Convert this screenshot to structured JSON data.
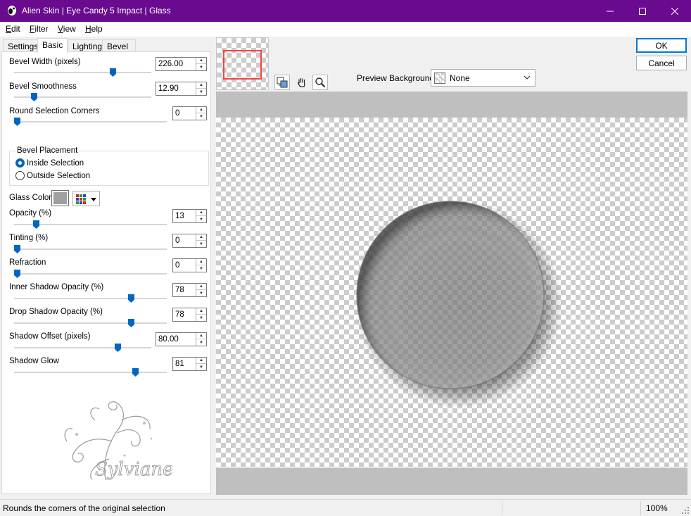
{
  "window": {
    "title": "Alien Skin | Eye Candy 5 Impact | Glass"
  },
  "menu": [
    {
      "key": "E",
      "rest": "dit"
    },
    {
      "key": "F",
      "rest": "ilter"
    },
    {
      "key": "V",
      "rest": "iew"
    },
    {
      "key": "H",
      "rest": "elp"
    }
  ],
  "tabs": {
    "settings": "Settings",
    "basic": "Basic",
    "lighting": "Lighting",
    "bevel_profile": "Bevel Profile",
    "active": "Basic"
  },
  "controls": {
    "bevel_width": {
      "label": "Bevel Width (pixels)",
      "value": "226.00",
      "level": 0.73
    },
    "bevel_smoothness": {
      "label": "Bevel Smoothness",
      "value": "12.90",
      "level": 0.13
    },
    "round_corners": {
      "label": "Round Selection Corners",
      "value": "0",
      "level": 0.0
    },
    "bevel_placement": {
      "legend": "Bevel Placement",
      "inside": "Inside Selection",
      "outside": "Outside Selection",
      "selected": "inside"
    },
    "glass_color": {
      "label": "Glass Color",
      "color": "#a0a0a0"
    },
    "opacity": {
      "label": "Opacity (%)",
      "value": "13",
      "level": 0.13
    },
    "tinting": {
      "label": "Tinting (%)",
      "value": "0",
      "level": 0.0
    },
    "refraction": {
      "label": "Refraction",
      "value": "0",
      "level": 0.0
    },
    "inner_shadow": {
      "label": "Inner Shadow Opacity (%)",
      "value": "78",
      "level": 0.78
    },
    "drop_shadow": {
      "label": "Drop Shadow Opacity (%)",
      "value": "78",
      "level": 0.78
    },
    "shadow_offset": {
      "label": "Shadow Offset (pixels)",
      "value": "80.00",
      "level": 0.77
    },
    "shadow_glow": {
      "label": "Shadow Glow",
      "value": "81",
      "level": 0.81
    }
  },
  "buttons": {
    "ok": "OK",
    "cancel": "Cancel"
  },
  "preview_background": {
    "label": "Preview Background:",
    "value": "None"
  },
  "watermark_text": "Sylviane",
  "status": {
    "text": "Rounds the corners of the original selection",
    "zoom": "100%"
  },
  "colors": {
    "titlebar": "#6a0a8e",
    "accent": "#0067c0",
    "thumb_frame": "#ff4040"
  }
}
